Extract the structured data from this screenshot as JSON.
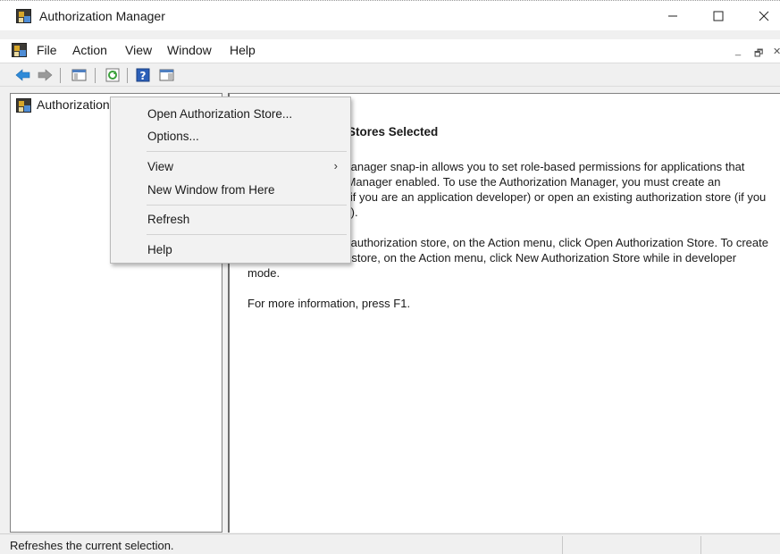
{
  "window": {
    "title": "Authorization Manager",
    "controls": {
      "minimize": "—",
      "maximize": "☐",
      "close": "✕"
    }
  },
  "menubar": {
    "items": [
      "File",
      "Action",
      "View",
      "Window",
      "Help"
    ],
    "mdi_controls": [
      "_",
      "🗗",
      "✕"
    ]
  },
  "toolbar": {
    "icons": [
      "back-arrow-icon",
      "forward-arrow-icon",
      "show-hide-console-tree-icon",
      "refresh-icon",
      "help-icon",
      "show-hide-action-pane-icon"
    ]
  },
  "tree": {
    "root_label": "Authorization Manager"
  },
  "content": {
    "title": "No Authorization Stores Selected",
    "paragraphs": [
      "The Authorization Manager snap-in allows you to set role-based permissions for applications that have Authorization Manager enabled. To use the Authorization Manager, you must create an authorization store (if you are an application developer) or open an existing authorization store (if you are an administrator).",
      "To open an existing authorization store, on the Action menu, click Open Authorization Store. To create a new authorization store, on the Action menu, click New Authorization Store while in developer mode.",
      "For more information, press F1."
    ]
  },
  "context_menu": {
    "items": [
      {
        "label": "Open Authorization Store..."
      },
      {
        "label": "Options..."
      },
      {
        "label": "View",
        "submenu": true
      },
      {
        "label": "New Window from Here"
      },
      {
        "label": "Refresh"
      },
      {
        "label": "Help"
      }
    ],
    "submenu_glyph": "›"
  },
  "statusbar": {
    "text": "Refreshes the current selection."
  },
  "colors": {
    "window_bg": "#f0f0f0",
    "pane_bg": "#ffffff",
    "back_arrow": "#2f8ad8",
    "refresh_green": "#3aa13a",
    "help_blue": "#2b5fb8"
  }
}
